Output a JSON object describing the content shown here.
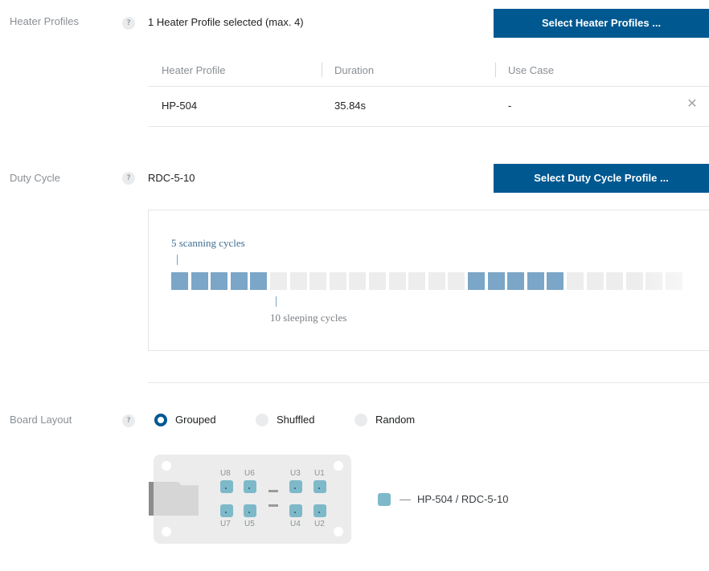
{
  "heater_profiles": {
    "label": "Heater Profiles",
    "help": "?",
    "status": "1 Heater Profile selected (max. 4)",
    "button_label": "Select Heater Profiles ...",
    "table": {
      "headers": [
        "Heater Profile",
        "Duration",
        "Use Case"
      ],
      "rows": [
        {
          "profile": "HP-504",
          "duration": "35.84s",
          "use_case": "-"
        }
      ],
      "remove_icon": "close-icon"
    }
  },
  "duty_cycle": {
    "label": "Duty Cycle",
    "help": "?",
    "value": "RDC-5-10",
    "button_label": "Select Duty Cycle Profile ...",
    "diagram": {
      "scanning_label": "5 scanning cycles",
      "sleeping_label": "10 sleeping cycles",
      "pattern": [
        "scan",
        "scan",
        "scan",
        "scan",
        "scan",
        "sleep",
        "sleep",
        "sleep",
        "sleep",
        "sleep",
        "sleep",
        "sleep",
        "sleep",
        "sleep",
        "sleep",
        "scan",
        "scan",
        "scan",
        "scan",
        "scan",
        "sleep",
        "sleep",
        "sleep",
        "sleep",
        "sleep",
        "sleep"
      ],
      "colors": {
        "scan": "#7ba6c7",
        "sleep": "#ededed"
      }
    }
  },
  "board_layout": {
    "label": "Board Layout",
    "help": "?",
    "options": [
      {
        "label": "Grouped",
        "checked": true
      },
      {
        "label": "Shuffled",
        "checked": false
      },
      {
        "label": "Random",
        "checked": false
      }
    ],
    "sensors": {
      "top_left": [
        "U8",
        "U6"
      ],
      "top_right": [
        "U3",
        "U1"
      ],
      "bottom_left": [
        "U7",
        "U5"
      ],
      "bottom_right": [
        "U4",
        "U2"
      ]
    },
    "legend": {
      "color": "#7db9c9",
      "text": "HP-504 / RDC-5-10"
    }
  },
  "colors": {
    "accent": "#005891"
  }
}
